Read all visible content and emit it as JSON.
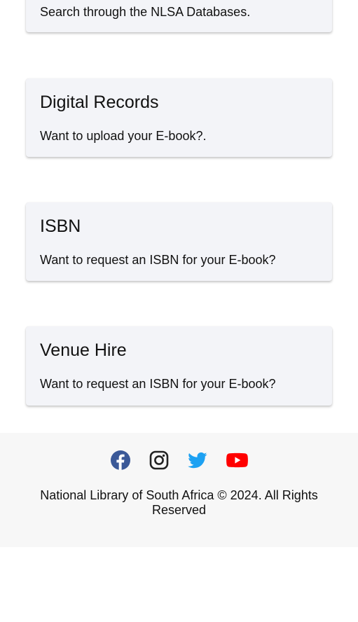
{
  "cards": [
    {
      "title": "",
      "description": "Search through the NLSA Databases."
    },
    {
      "title": "Digital Records",
      "description": "Want to upload your E-book?."
    },
    {
      "title": "ISBN",
      "description": "Want to request an ISBN for your E-book?"
    },
    {
      "title": "Venue Hire",
      "description": "Want to request an ISBN for your E-book?"
    }
  ],
  "footer": {
    "social": [
      "facebook-icon",
      "instagram-icon",
      "twitter-icon",
      "youtube-icon"
    ],
    "colors": {
      "facebook": "#3b5998",
      "instagram": "#222222",
      "twitter": "#1da1f2",
      "youtube": "#ff0000"
    },
    "copyright": "National Library of South Africa © 2024. All Rights Reserved"
  }
}
